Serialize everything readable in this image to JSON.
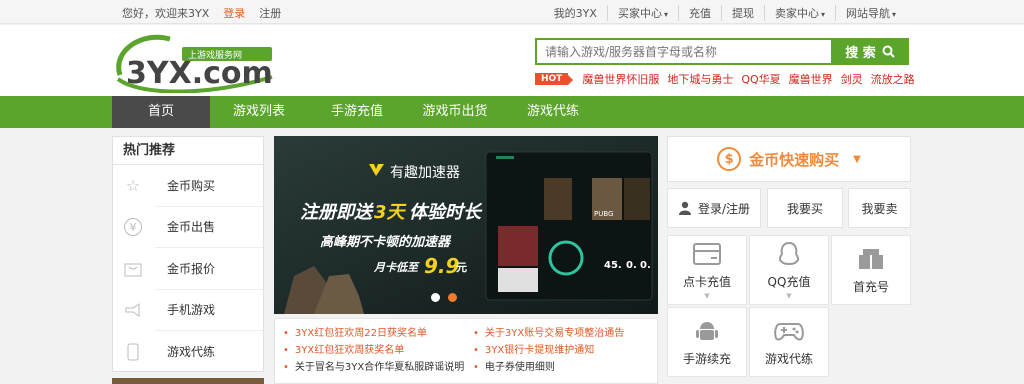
{
  "topbar": {
    "greeting": "您好，欢迎来3YX",
    "login": "登录",
    "register": "注册",
    "right_links": [
      "我的3YX",
      "买家中心",
      "充值",
      "提现",
      "卖家中心",
      "网站导航"
    ]
  },
  "logo": {
    "main": "3YX.com",
    "tag": "上游戏服务网"
  },
  "search": {
    "placeholder": "请输入游戏/服务器首字母或名称",
    "button": "搜 索",
    "hot_badge": "HOT",
    "hot_links": [
      "魔兽世界怀旧服",
      "地下城与勇士",
      "QQ华夏",
      "魔兽世界",
      "剑灵",
      "流放之路"
    ]
  },
  "nav": {
    "items": [
      "首页",
      "游戏列表",
      "手游充值",
      "游戏币出货",
      "游戏代练"
    ]
  },
  "sidebar": {
    "title": "热门推荐",
    "items": [
      "金币购买",
      "金币出售",
      "金币报价",
      "手机游戏",
      "游戏代练"
    ]
  },
  "banner": {
    "brand": "有趣加速器",
    "headline_a": "注册即送",
    "headline_b": "3天",
    "headline_c": "体验时长",
    "slogan": "高峰期不卡顿的加速器",
    "price_label": "月卡低至",
    "price": "9.9",
    "price_unit": "元",
    "game_title": "PUBG",
    "stat_a": "45.",
    "stat_b": "0.",
    "stat_c": "0."
  },
  "news": {
    "left": [
      "3YX红包狂欢周22日获奖名单",
      "3YX红包狂欢周获奖名单",
      "关于冒名与3YX合作华夏私服辟谣说明"
    ],
    "right": [
      "关于3YX账号交易专项整治通告",
      "3YX银行卡提现维护通知",
      "电子券使用细则"
    ]
  },
  "right_panel": {
    "gold_buy": "金币快速购买",
    "login_register": "登录/注册",
    "i_buy": "我要买",
    "i_sell": "我要卖",
    "grid": [
      "点卡充值",
      "QQ充值",
      "首充号",
      "手游续充",
      "游戏代练"
    ]
  },
  "colors": {
    "brand_green": "#5ba52c",
    "accent_orange": "#f08a3c",
    "hot_red": "#e8512c"
  }
}
